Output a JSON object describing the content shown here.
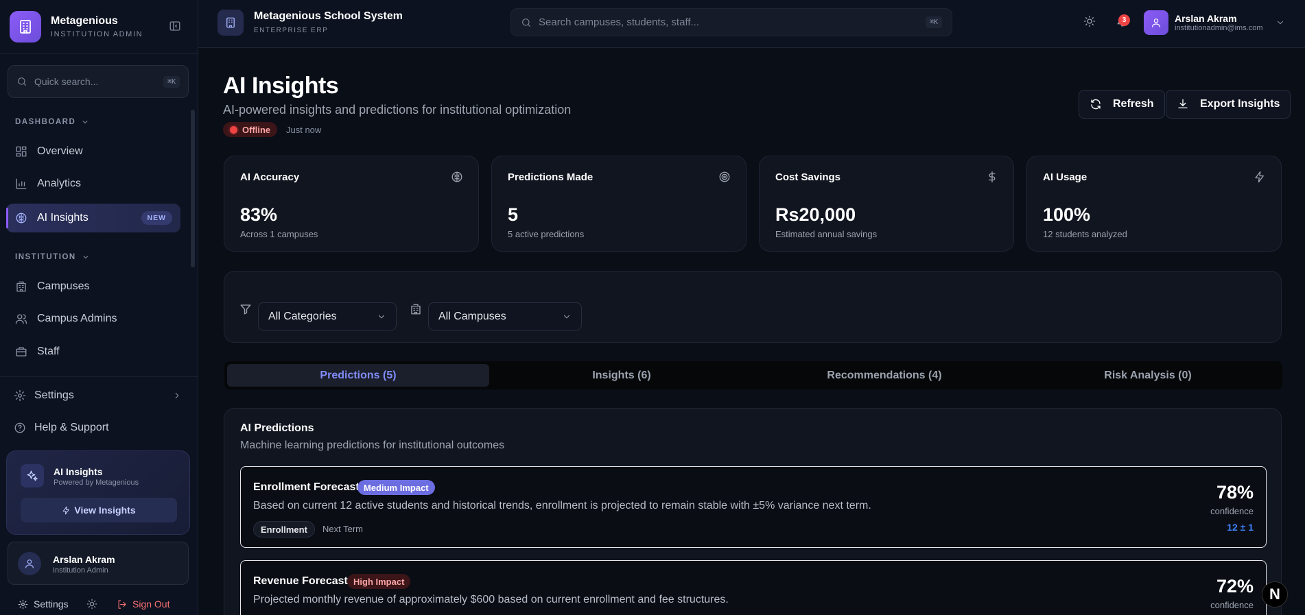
{
  "sidebar": {
    "brand_name": "Metagenious",
    "brand_sub": "INSTITUTION ADMIN",
    "search_placeholder": "Quick search...",
    "search_shortcut": "⌘K",
    "section_dashboard": "DASHBOARD",
    "section_institution": "INSTITUTION",
    "items": [
      {
        "label": "Overview",
        "icon": "grid-icon"
      },
      {
        "label": "Analytics",
        "icon": "bar-chart-icon"
      },
      {
        "label": "AI Insights",
        "icon": "brain-icon",
        "badge": "NEW",
        "active": true
      },
      {
        "label": "Campuses",
        "icon": "building-icon"
      },
      {
        "label": "Campus Admins",
        "icon": "users-icon"
      },
      {
        "label": "Staff",
        "icon": "briefcase-icon"
      }
    ],
    "settings_label": "Settings",
    "help_label": "Help & Support",
    "ai_card": {
      "title": "AI Insights",
      "subtitle": "Powered by Metagenious",
      "button": "View Insights"
    },
    "user": {
      "name": "Arslan Akram",
      "role": "Institution Admin"
    },
    "footer": {
      "settings": "Settings",
      "sign_out": "Sign Out"
    }
  },
  "header": {
    "title": "Metagenious School System",
    "subtitle": "ENTERPRISE ERP",
    "search_placeholder": "Search campuses, students, staff...",
    "search_shortcut": "⌘K",
    "notifications": "3",
    "user_name": "Arslan Akram",
    "user_email": "institutionadmin@ims.com"
  },
  "page": {
    "title": "AI Insights",
    "subtitle": "AI-powered insights and predictions for institutional optimization",
    "status": "Offline",
    "status_time": "Just now",
    "refresh_label": "Refresh",
    "export_label": "Export Insights"
  },
  "stats": [
    {
      "title": "AI Accuracy",
      "value": "83%",
      "desc": "Across 1 campuses",
      "icon": "brain-icon"
    },
    {
      "title": "Predictions Made",
      "value": "5",
      "desc": "5 active predictions",
      "icon": "target-icon"
    },
    {
      "title": "Cost Savings",
      "value": "Rs20,000",
      "desc": "Estimated annual savings",
      "icon": "dollar-icon"
    },
    {
      "title": "AI Usage",
      "value": "100%",
      "desc": "12 students analyzed",
      "icon": "zap-icon"
    }
  ],
  "filters": {
    "category": "All Categories",
    "campus": "All Campuses"
  },
  "tabs": [
    {
      "label": "Predictions (5)",
      "active": true
    },
    {
      "label": "Insights (6)"
    },
    {
      "label": "Recommendations (4)"
    },
    {
      "label": "Risk Analysis (0)"
    }
  ],
  "predictions": {
    "title": "AI Predictions",
    "subtitle": "Machine learning predictions for institutional outcomes",
    "items": [
      {
        "name": "Enrollment Forecast",
        "impact": "Medium Impact",
        "desc": "Based on current 12 active students and historical trends, enrollment is projected to remain stable with ±5% variance next term.",
        "tag": "Enrollment",
        "period": "Next Term",
        "confidence": "78%",
        "confidence_label": "confidence",
        "range": "12 ± 1"
      },
      {
        "name": "Revenue Forecast",
        "impact": "High Impact",
        "desc": "Projected monthly revenue of approximately $600 based on current enrollment and fee structures.",
        "confidence": "72%",
        "confidence_label": "confidence"
      }
    ]
  },
  "colors": {
    "accent": "#8b5cf6",
    "indigo": "#818cf8",
    "danger": "#ef4444",
    "background": "#0a0e17"
  },
  "fab_label": "N"
}
